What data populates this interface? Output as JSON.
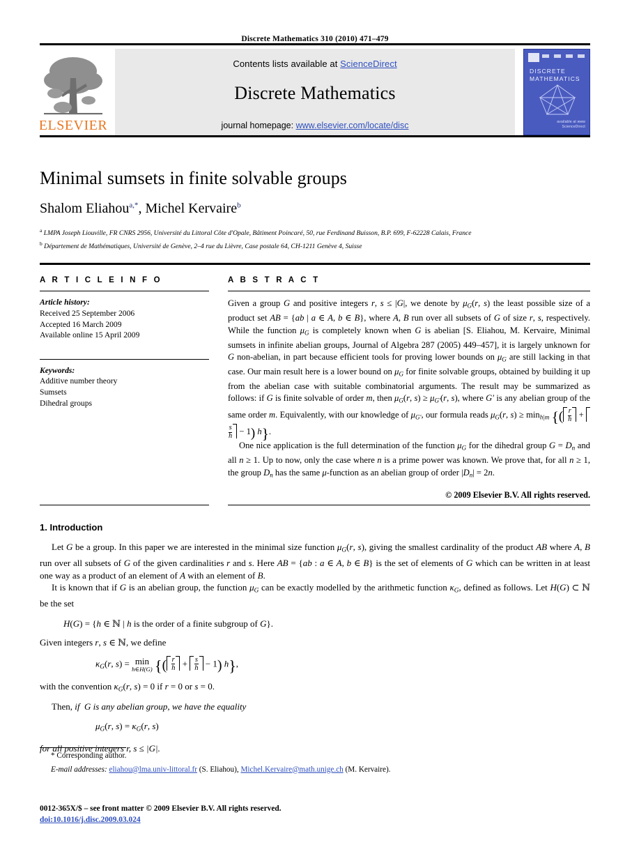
{
  "running_head": "Discrete Mathematics 310 (2010) 471–479",
  "banner": {
    "contents_prefix": "Contents lists available at ",
    "contents_link": "ScienceDirect",
    "journal_name": "Discrete Mathematics",
    "homepage_prefix": "journal homepage: ",
    "homepage_link": "www.elsevier.com/locate/disc",
    "publisher_logo_text": "ELSEVIER",
    "logo_color": "#e87722",
    "panel_bg": "#e9e9e9",
    "link_color": "#2f4fbf"
  },
  "cover": {
    "title_line1": "DISCRETE",
    "title_line2": "MATHEMATICS",
    "sciencedirect_line1": "available at www",
    "sciencedirect_line2": "ScienceDirect",
    "bg_color": "#4a5bbf"
  },
  "article": {
    "title": "Minimal sumsets in finite solvable groups",
    "authors": [
      {
        "name": "Shalom Eliahou",
        "sup": "a,",
        "star": "*"
      },
      {
        "name": "Michel Kervaire",
        "sup": "b"
      }
    ],
    "author_separator": ", ",
    "affiliations": [
      {
        "marker": "a",
        "text": "LMPA Joseph Liouville, FR CNRS 2956, Université du Littoral Côte d'Opale, Bâtiment Poincaré, 50, rue Ferdinand Buisson, B.P. 699, F-62228 Calais, France"
      },
      {
        "marker": "b",
        "text": "Département de Mathématiques, Université de Genève, 2–4 rue du Lièvre, Case postale 64, CH-1211 Genève 4, Suisse"
      }
    ]
  },
  "article_info": {
    "heading": "A R T I C L E   I N F O",
    "history_label": "Article history:",
    "history": [
      "Received 25 September 2006",
      "Accepted 16 March 2009",
      "Available online 15 April 2009"
    ],
    "keywords_label": "Keywords:",
    "keywords": [
      "Additive number theory",
      "Sumsets",
      "Dihedral groups"
    ]
  },
  "abstract": {
    "heading": "A B S T R A C T",
    "para1_a": "Given a group ",
    "para1_b": " and positive integers ",
    "para1_text": "Given a group G and positive integers r, s ≤ |G|, we denote by μG(r, s) the least possible size of a product set AB = {ab | a ∈ A, b ∈ B}, where A, B run over all subsets of G of size r, s, respectively. While the function μG is completely known when G is abelian [S. Eliahou, M. Kervaire, Minimal sumsets in infinite abelian groups, Journal of Algebra 287 (2005) 449–457], it is largely unknown for G non-abelian, in part because efficient tools for proving lower bounds on μG are still lacking in that case. Our main result here is a lower bound on μG for finite solvable groups, obtained by building it up from the abelian case with suitable combinatorial arguments. The result may be summarized as follows: if G is finite solvable of order m, then μG(r, s) ≥ μG′(r, s), where G′ is any abelian group of the same order m. Equivalently, with our knowledge of μG′, our formula reads μG(r, s) ≥ min h|m {(⌈r/h⌉ + ⌈s/h⌉ − 1) h}.",
    "para2_text": "One nice application is the full determination of the function μG for the dihedral group G = Dn and all n ≥ 1. Up to now, only the case where n is a prime power was known. We prove that, for all n ≥ 1, the group Dn has the same μ-function as an abelian group of order |Dn| = 2n.",
    "copyright": "© 2009 Elsevier B.V. All rights reserved."
  },
  "introduction": {
    "number": "1.",
    "title": "Introduction",
    "para1": "Let G be a group. In this paper we are interested in the minimal size function μG(r, s), giving the smallest cardinality of the product AB where A, B run over all subsets of G of the given cardinalities r and s. Here AB = {ab : a ∈ A, b ∈ B} is the set of elements of G which can be written in at least one way as a product of an element of A with an element of B.",
    "para2": "It is known that if G is an abelian group, the function μG can be exactly modelled by the arithmetic function κG, defined as follows. Let H(G) ⊂ N be the set",
    "eq_set": "H(G) = {h ∈ N | h is the order of a finite subgroup of G}.",
    "lead_given": "Given integers r, s ∈ N, we define",
    "eq_kappa": "κG(r, s) = min h∈H(G) {(⌈r/h⌉ + ⌈s/h⌉ − 1) h},",
    "convention": "with the convention κG(r, s) = 0 if r = 0 or s = 0.",
    "then_line": "Then, if G is any abelian group, we have the equality",
    "eq_mu": "μG(r, s) = κG(r, s)",
    "for_all_line": "for all positive integers r, s ≤ |G|."
  },
  "footnotes": {
    "corresponding_marker": "*",
    "corresponding_text": "Corresponding author.",
    "emails_label": "E-mail addresses:",
    "email1": "eliahou@lma.univ-littoral.fr",
    "email1_who": "(S. Eliahou),",
    "email2": "Michel.Kervaire@math.unige.ch",
    "email2_who": "(M. Kervaire)."
  },
  "imprint": {
    "line1": "0012-365X/$ – see front matter © 2009 Elsevier B.V. All rights reserved.",
    "doi": "doi:10.1016/j.disc.2009.03.024"
  }
}
